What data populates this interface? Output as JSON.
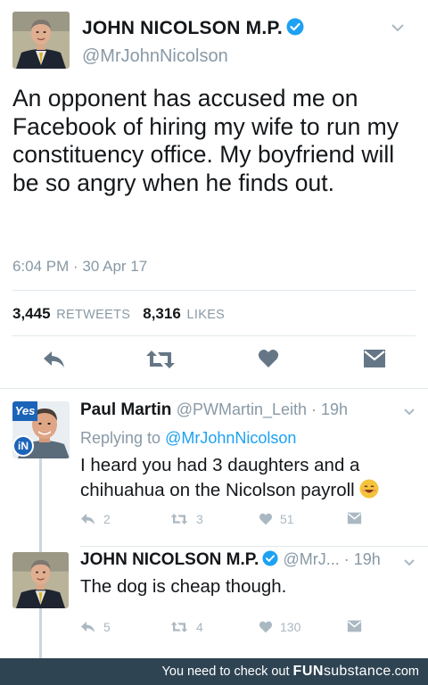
{
  "main_tweet": {
    "author_name": "JOHN NICOLSON M.P.",
    "handle": "@MrJohnNicolson",
    "text": "An opponent has accused me on Facebook of hiring my wife to run my constituency office. My boyfriend will be so angry when he finds out.",
    "timestamp": "6:04 PM · 30 Apr 17",
    "retweets_count": "3,445",
    "retweets_label": "RETWEETS",
    "likes_count": "8,316",
    "likes_label": "LIKES",
    "actions": [
      {
        "icon": "reply-icon"
      },
      {
        "icon": "retweet-icon"
      },
      {
        "icon": "heart-icon"
      },
      {
        "icon": "message-icon"
      }
    ]
  },
  "replies": [
    {
      "author_name": "Paul Martin",
      "meta": "@PWMartin_Leith · 19h",
      "replying_prefix": "Replying to ",
      "replying_to": "@MrJohnNicolson",
      "text": "I heard you had 3 daughters and a chihuahua on the Nicolson payroll",
      "emoji": "😊",
      "badge_top": "Yes",
      "badge_bottom": "iN",
      "reply_count": "2",
      "retweet_count": "3",
      "like_count": "51"
    },
    {
      "author_name": "JOHN NICOLSON M.P.",
      "meta": "@MrJ... · 19h",
      "text": "The dog is cheap though.",
      "reply_count": "5",
      "retweet_count": "4",
      "like_count": "130"
    }
  ],
  "footer": {
    "text": "You need to check out ",
    "brand_bold": "FUN",
    "brand_rest": "substance",
    "brand_suffix": ".com"
  },
  "colors": {
    "verified_blue": "#1da1f2",
    "muted": "#8899a6",
    "icon_gray": "#aab8c2",
    "action_dark": "#657786",
    "footer_bg": "#2f4453"
  }
}
